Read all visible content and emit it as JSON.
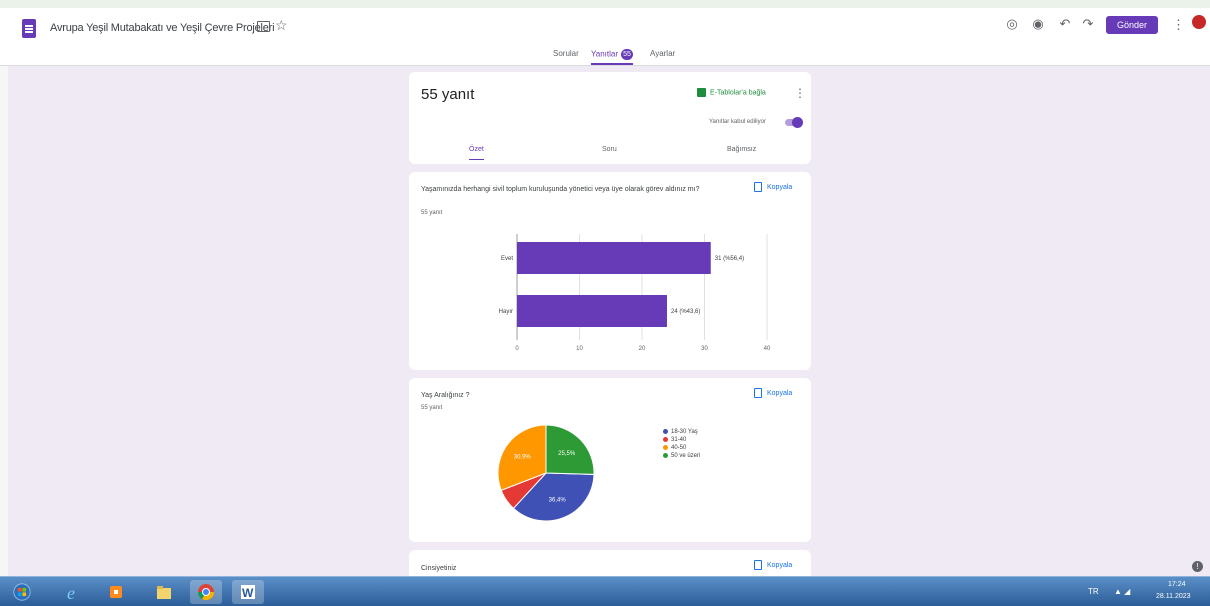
{
  "header": {
    "title": "Avrupa Yeşil Mutabakatı ve Yeşil Çevre Projeleri",
    "send_label": "Gönder",
    "tabs": [
      {
        "label": "Sorular"
      },
      {
        "label": "Yanıtlar",
        "badge": "55"
      },
      {
        "label": "Ayarlar"
      }
    ]
  },
  "summary": {
    "responses": "55 yanıt",
    "sheets_link": "E-Tablolar'a bağla",
    "accepting": "Yanıtlar kabul ediliyor",
    "subtabs": [
      "Özet",
      "Soru",
      "Bağımsız"
    ]
  },
  "question1": {
    "title": "Yaşamınızda herhangi sivil toplum kuruluşunda yönetici veya üye olarak görev aldınız mı?",
    "count": "55 yanıt",
    "copy_label": "Kopyala"
  },
  "question2": {
    "title": "Yaş Aralığınız ?",
    "count": "55 yanıt",
    "copy_label": "Kopyala",
    "legend": [
      "18-30 Yaş",
      "31-40",
      "40-50",
      "50 ve üzeri"
    ]
  },
  "question3": {
    "title": "Cinsiyetiniz",
    "copy_label": "Kopyala"
  },
  "chart_data": [
    {
      "type": "bar",
      "orientation": "horizontal",
      "categories": [
        "Evet",
        "Hayır"
      ],
      "values": [
        31,
        24
      ],
      "data_labels": [
        "31 (%56,4)",
        "24 (%43,6)"
      ],
      "xlim": [
        0,
        40
      ],
      "xticks": [
        "0",
        "10",
        "20",
        "30",
        "40"
      ],
      "color": "#673ab7"
    },
    {
      "type": "pie",
      "categories": [
        "18-30 Yaş",
        "31-40",
        "40-50",
        "50 ve üzeri"
      ],
      "values": [
        36.4,
        7.3,
        30.9,
        25.5
      ],
      "data_labels": [
        "36,4%",
        "",
        "30,9%",
        "25,5%"
      ],
      "colors": [
        "#3f51b5",
        "#e53935",
        "#ff9800",
        "#2e9a35"
      ],
      "legend": "right"
    }
  ],
  "taskbar": {
    "language": "TR",
    "time": "17:24",
    "date": "28.11.2023"
  }
}
